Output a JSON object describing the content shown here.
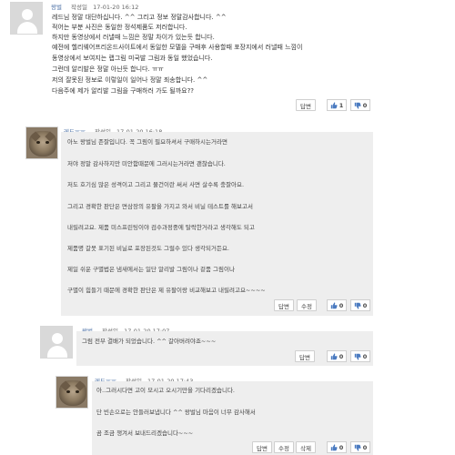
{
  "comments": [
    {
      "author": "왕벌",
      "meta": "작성일",
      "date": "17-01-20 16:12",
      "lines": [
        "레드님 정말 대단하십니다. ^^ 그리고 정보 정말감사합니다. ^^",
        "적어는 부분 사진은  동일한 정석제품도 저러합니다.",
        "하지만 동영상에서 러낼때 느낌은 정말 차이가 있는듯 합니다.",
        "예전에 헬리웨어프리온드사이트에서 동일한 모델을 구매후 사용할때 포장지에서 러낼때 느낌이",
        "동영상에서 보여지는 랩그림 미국발 그림과 동일 했었습니다.",
        "그런데 알리발은 정말 아닌듯 합니다. ㅠㅠ",
        "저의 잘못된 정보로 이렇일이 일어나 정말 죄송합니다. ^^",
        "다음주에 제가 알리발 그림을 구매하러 가도 될까요??"
      ],
      "buttons": [
        "답변"
      ],
      "up": "1",
      "down": "0"
    },
    {
      "author": "레드ㅠㅠ",
      "meta": "작성일",
      "date": "17-01-20 16:18",
      "lines": [
        "아노 왕벌님 존잘입니다. 꼭 그림이 필요하셔서 구매하시는거라면",
        "저야 정말 감사하지만 미안함때문에 그러시는거라면 괜찮습니다.",
        "저도 호기심 많은 성격이고 그리고 물건이란 써서 사면 살수록 충잘아요.",
        "그리고 경확한 판단은 면삼장의 유팔을 가지고 와서 비닐 테스트를 해보고서",
        "내릴려고요. 제품 미스프린팅이야 검수과정중에 탈락한거라고 생각해도 되고",
        "제품명 갈못 표기된 비닐로 포장된것도 그럴수 있다 생각되거든요.",
        "제일 쉬운 구별법은 냄새에서는 일단 알리발 그림이나 겉품 그림이나",
        "구별이 힘들기 때문에 경확한 판단은 제 유팔이랑 비교해보고 내릴려고요~~~~"
      ],
      "buttons": [
        "답변",
        "수정"
      ],
      "up": "0",
      "down": "0"
    },
    {
      "author": "왕벌",
      "meta": "작성일",
      "date": "17-01-20 17:07",
      "lines": [
        "그럼 전부 결배가 되었습니다. ^^ 갈아버려야죠~~~"
      ],
      "buttons": [
        "답변"
      ],
      "up": "0",
      "down": "0"
    },
    {
      "author": "레드ㅠㅠ",
      "meta": "작성일",
      "date": "17-01-20 17:43",
      "lines": [
        "아..그러시다면 고이 모시고 오시기만을 기다리겠습니다.",
        "단 빈손으로는 안들러보냅니다 ^^  왕벌님 마음이 너무 감사해서",
        "곰 조금 챙겨서 보내드리겠습니다~~~"
      ],
      "buttons": [
        "답변",
        "수정",
        "삭제"
      ],
      "up": "0",
      "down": "0"
    }
  ]
}
